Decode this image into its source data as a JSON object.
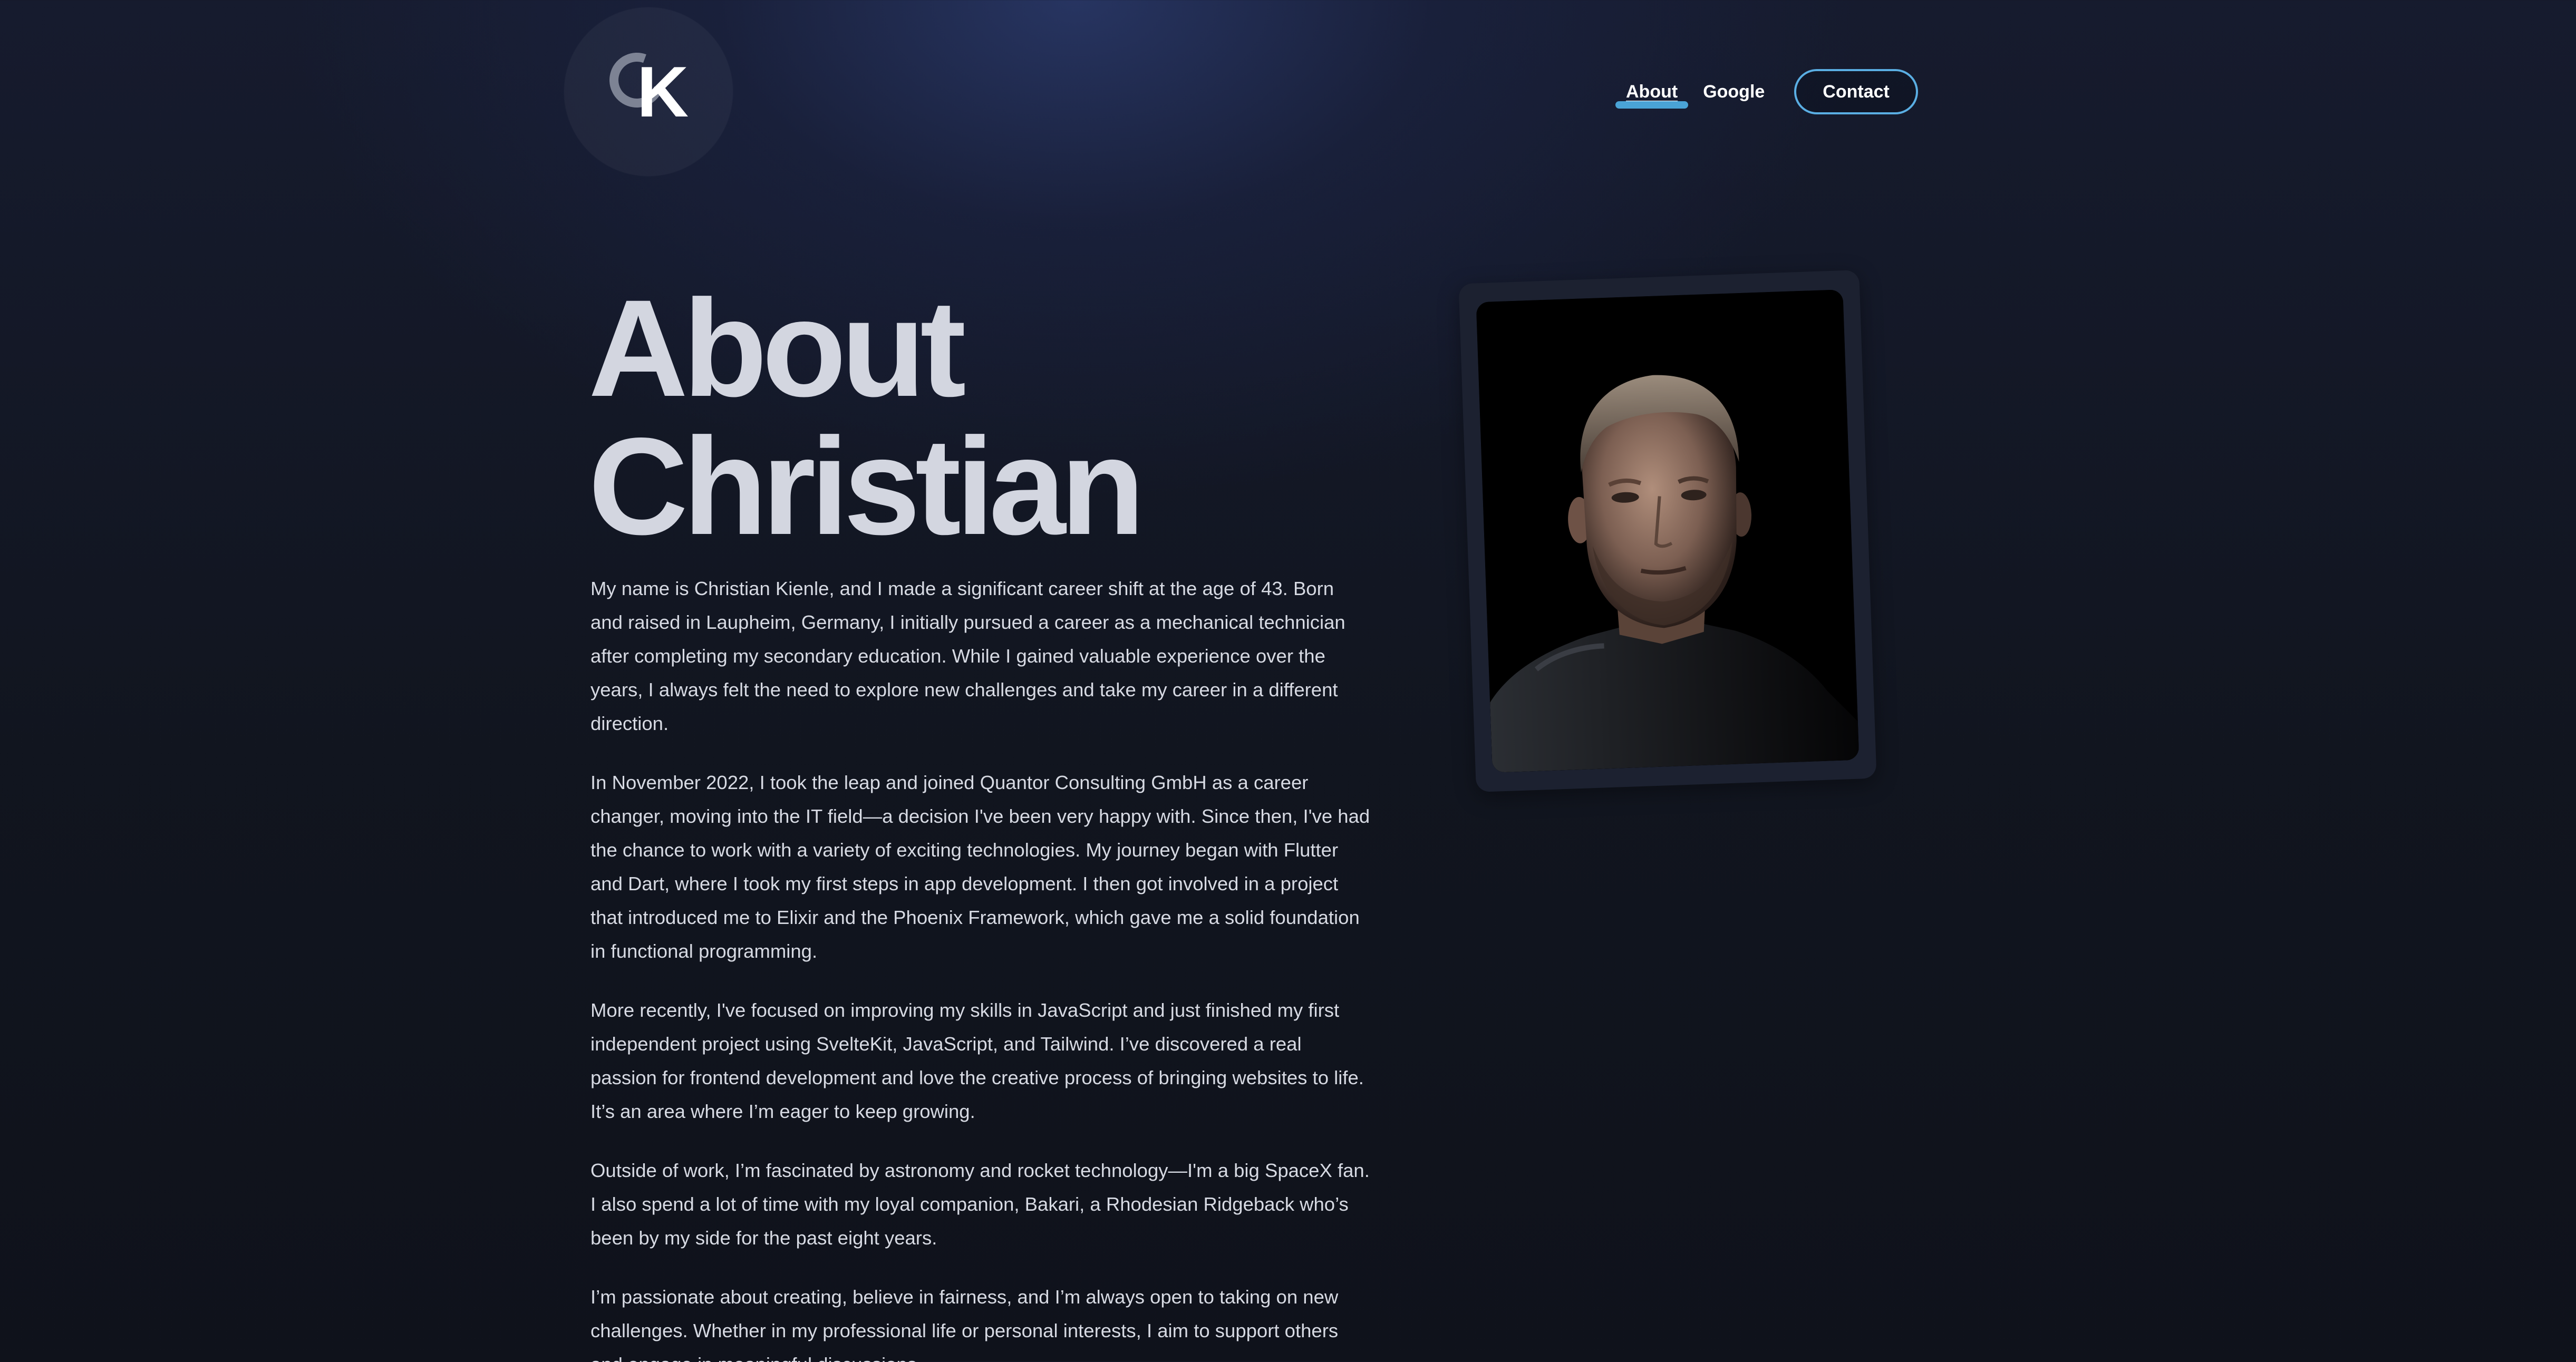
{
  "logo": {
    "letter_c": "C",
    "letter_k": "K"
  },
  "nav": {
    "items": [
      {
        "label": "About",
        "active": true
      },
      {
        "label": "Google",
        "active": false
      }
    ],
    "contact_label": "Contact"
  },
  "colors": {
    "accent": "#4aa3d6",
    "background": "#101421",
    "title": "#d3d6e0"
  },
  "page": {
    "title_line1": "About",
    "title_line2": "Christian",
    "paragraphs": [
      "My name is Christian Kienle, and I made a significant career shift at the age of 43. Born and raised in Laupheim, Germany, I initially pursued a career as a mechanical technician after completing my secondary education. While I gained valuable experience over the years, I always felt the need to explore new challenges and take my career in a different direction.",
      "In November 2022, I took the leap and joined Quantor Consulting GmbH as a career changer, moving into the IT field—a decision I've been very happy with. Since then, I've had the chance to work with a variety of exciting technologies. My journey began with Flutter and Dart, where I took my first steps in app development. I then got involved in a project that introduced me to Elixir and the Phoenix Framework, which gave me a solid foundation in functional programming.",
      "More recently, I've focused on improving my skills in JavaScript and just finished my first independent project using SvelteKit, JavaScript, and Tailwind. I’ve discovered a real passion for frontend development and love the creative process of bringing websites to life. It’s an area where I’m eager to keep growing.",
      "Outside of work, I’m fascinated by astronomy and rocket technology—I'm a big SpaceX fan. I also spend a lot of time with my loyal companion, Bakari, a Rhodesian Ridgeback who’s been by my side for the past eight years.",
      "I’m passionate about creating, believe in fairness, and I’m always open to taking on new challenges. Whether in my professional life or personal interests, I aim to support others and engage in meaningful discussions."
    ]
  }
}
